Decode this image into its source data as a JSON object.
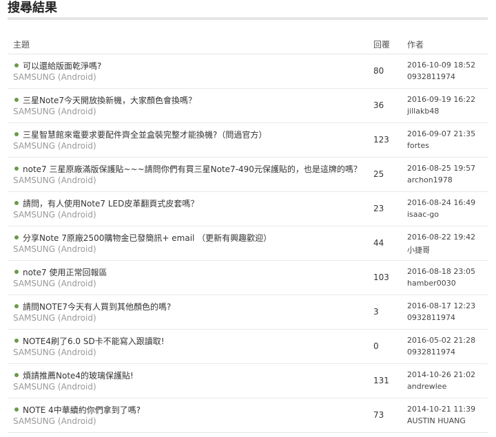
{
  "page": {
    "title": "搜尋結果"
  },
  "table": {
    "headers": {
      "topic": "主題",
      "replies": "回覆",
      "author": "作者"
    },
    "rows": [
      {
        "title": "可以還給版面乾淨嗎?",
        "forum": "SAMSUNG (Android)",
        "replies": "80",
        "date": "2016-10-09 18:52",
        "author": "0932811974"
      },
      {
        "title": "三星Note7今天開放換新機，大家顏色會換嗎？",
        "forum": "SAMSUNG (Android)",
        "replies": "36",
        "date": "2016-09-19 16:22",
        "author": "jillakb48"
      },
      {
        "title": "三星智慧館來電要求要配件齊全並盒裝完整才能換機?（問過官方）",
        "forum": "SAMSUNG (Android)",
        "replies": "123",
        "date": "2016-09-07 21:35",
        "author": "fortes"
      },
      {
        "title": "note7 三星原廠滿版保護貼~~~請問你們有買三星Note7-490元保護貼的，也是這牌的嗎？",
        "forum": "SAMSUNG (Android)",
        "replies": "25",
        "date": "2016-08-25 19:57",
        "author": "archon1978"
      },
      {
        "title": "請問，有人使用Note7 LED皮革翻頁式皮套嗎？",
        "forum": "SAMSUNG (Android)",
        "replies": "23",
        "date": "2016-08-24 16:49",
        "author": "isaac-go"
      },
      {
        "title": "分享Note 7原廠2500購物金已發簡訊+ email （更新有興趣歡迎）",
        "forum": "SAMSUNG (Android)",
        "replies": "44",
        "date": "2016-08-22 19:42",
        "author": "小捷哥"
      },
      {
        "title": "note7 使用正常回報區",
        "forum": "SAMSUNG (Android)",
        "replies": "103",
        "date": "2016-08-18 23:05",
        "author": "hamber0030"
      },
      {
        "title": "請問NOTE7今天有人買到其他顏色的嗎?",
        "forum": "SAMSUNG (Android)",
        "replies": "3",
        "date": "2016-08-17 12:23",
        "author": "0932811974"
      },
      {
        "title": "NOTE4刷了6.0 SD卡不能寫入跟讀取!",
        "forum": "SAMSUNG (Android)",
        "replies": "0",
        "date": "2016-05-02 21:28",
        "author": "0932811974"
      },
      {
        "title": "煩請推薦Note4的玻璃保護貼!",
        "forum": "SAMSUNG (Android)",
        "replies": "131",
        "date": "2014-10-26 21:02",
        "author": "andrewlee"
      },
      {
        "title": "NOTE 4中華續約你們拿到了嗎?",
        "forum": "SAMSUNG (Android)",
        "replies": "73",
        "date": "2014-10-21 11:39",
        "author": "AUSTIN HUANG"
      }
    ]
  },
  "colors": {
    "bullet": "#6a9a4a",
    "forum_text": "#999999",
    "divider": "#e8e8e8"
  },
  "icons": {
    "bullet": "green-dot-icon"
  }
}
